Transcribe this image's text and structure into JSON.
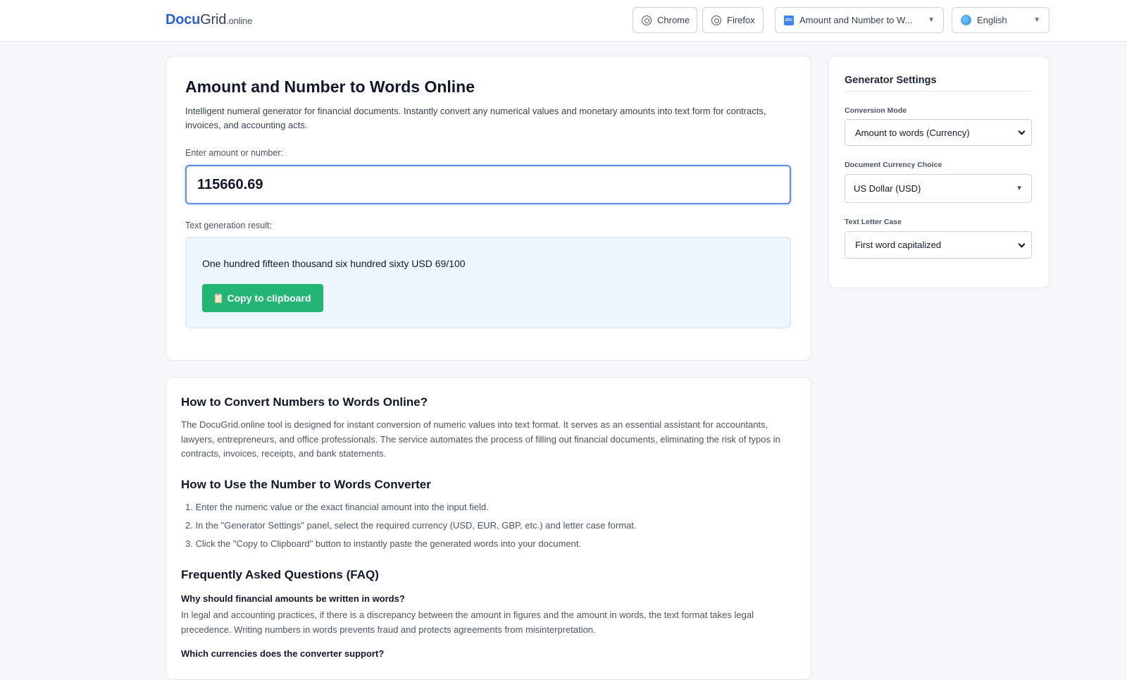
{
  "header": {
    "logo": {
      "primary": "Docu",
      "secondary": "Grid",
      "tld": ".online"
    },
    "chrome_label": "Chrome",
    "firefox_label": "Firefox",
    "tool_selector": "Amount and Number to W...",
    "language": "English"
  },
  "main": {
    "title": "Amount and Number to Words Online",
    "description": "Intelligent numeral generator for financial documents. Instantly convert any numerical values and monetary amounts into text form for contracts, invoices, and accounting acts.",
    "input_label": "Enter amount or number:",
    "input_value": "115660.69",
    "result_label": "Text generation result:",
    "result_text": "One hundred fifteen thousand six hundred sixty USD 69/100",
    "copy_button": "Copy to clipboard"
  },
  "settings": {
    "title": "Generator Settings",
    "mode_label": "Conversion Mode",
    "mode_value": "Amount to words (Currency)",
    "currency_label": "Document Currency Choice",
    "currency_value": "US Dollar (USD)",
    "case_label": "Text Letter Case",
    "case_value": "First word capitalized"
  },
  "info": {
    "h_convert": "How to Convert Numbers to Words Online?",
    "p_convert": "The DocuGrid.online tool is designed for instant conversion of numeric values into text format. It serves as an essential assistant for accountants, lawyers, entrepreneurs, and office professionals. The service automates the process of filling out financial documents, eliminating the risk of typos in contracts, invoices, receipts, and bank statements.",
    "h_use": "How to Use the Number to Words Converter",
    "steps": [
      "1. Enter the numeric value or the exact financial amount into the input field.",
      "2. In the \"Generator Settings\" panel, select the required currency (USD, EUR, GBP, etc.) and letter case format.",
      "3. Click the \"Copy to Clipboard\" button to instantly paste the generated words into your document."
    ],
    "h_faq": "Frequently Asked Questions (FAQ)",
    "q1": "Why should financial amounts be written in words?",
    "a1": "In legal and accounting practices, if there is a discrepancy between the amount in figures and the amount in words, the text format takes legal precedence. Writing numbers in words prevents fraud and protects agreements from misinterpretation.",
    "q2": "Which currencies does the converter support?"
  },
  "colors": {
    "brand": "#2d5fcf",
    "copy_button": "#22b573",
    "result_bg": "#eef6fd",
    "input_focus": "#5b8dee"
  }
}
